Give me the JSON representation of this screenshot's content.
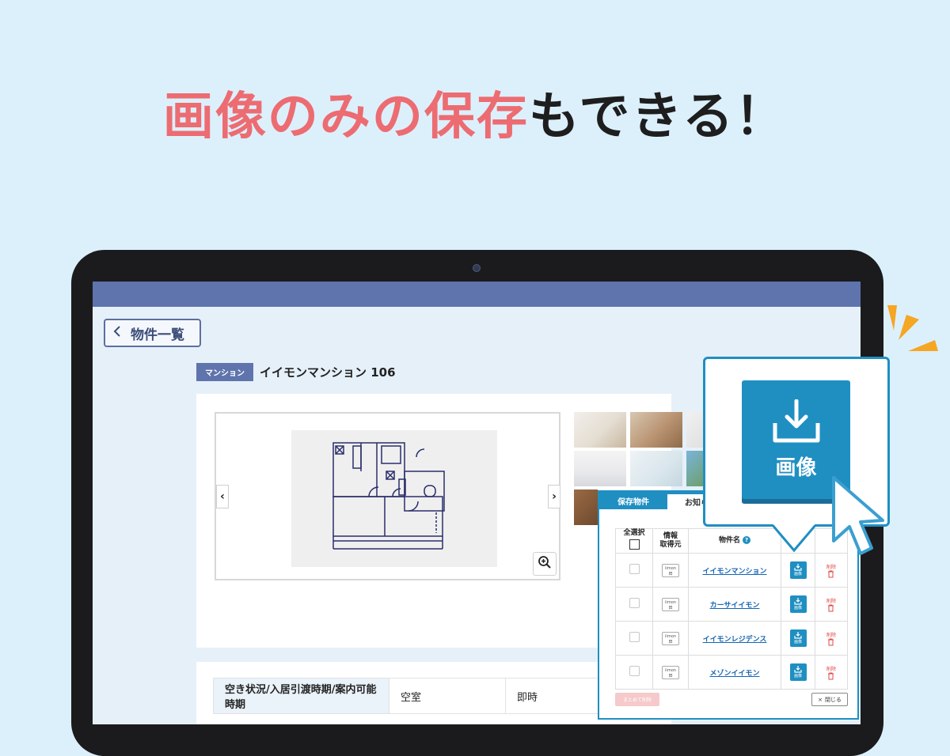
{
  "headline": {
    "accent": "画像のみの保存",
    "rest": "もできる！"
  },
  "colors": {
    "background": "#dcf0fc",
    "accent": "#ec6c72",
    "header_bar": "#5f74ad",
    "brand_blue": "#1f8fc2",
    "delete_red": "#e04747",
    "sparkle": "#f5a623"
  },
  "page": {
    "back_button": "物件一覧",
    "type_badge": "マンション",
    "property_title": "イイモンマンション 106"
  },
  "info": {
    "label": "空き状況/入居引渡時期/案内可能時期",
    "status": "空室",
    "move_in": "即時"
  },
  "saved_panel": {
    "tab_saved": "保存物件",
    "tab_news": "お知ら",
    "headers": {
      "select_all": "全選択",
      "source_line1": "情報",
      "source_line2": "取得元",
      "name": "物件名"
    },
    "source_logo_line1": "iimon",
    "source_logo_line2": "田",
    "image_button_label": "画像",
    "delete_line1": "削除",
    "rows": [
      {
        "name": "イイモンマンション"
      },
      {
        "name": "カーサイイモン"
      },
      {
        "name": "イイモンレジデンス"
      },
      {
        "name": "メゾンイイモン"
      }
    ],
    "bulk_delete": "まとめて削除",
    "close": "閉じる"
  },
  "callout": {
    "button_label": "画像",
    "icon": "download-icon"
  }
}
